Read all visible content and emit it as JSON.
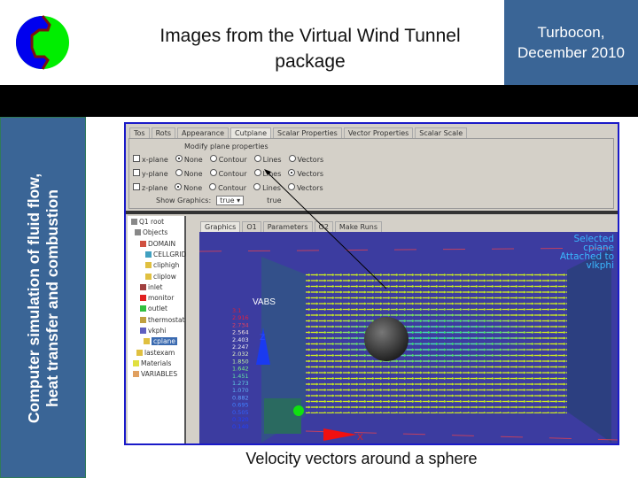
{
  "slide": {
    "title": "Images from the  Virtual Wind Tunnel package",
    "title_line1": "Images from the  Virtual Wind Tunnel",
    "title_line2": "package",
    "brand_line1": "Turbocon,",
    "brand_line2": "December 2010",
    "sidebar_line1": "Computer simulation of fluid flow,",
    "sidebar_line2": "heat transfer and combustion",
    "caption": "Velocity vectors around a sphere",
    "colors": {
      "brand_blue": "#3a6596",
      "band": "#000000",
      "frame": "#1a1ac8"
    }
  },
  "gui": {
    "top_tabs": [
      "Tos",
      "Rots",
      "Appearance",
      "Cutplane",
      "Scalar Properties",
      "Vector Properties",
      "Scalar Scale"
    ],
    "panel_title": "Modify plane properties",
    "rows": [
      {
        "label": "x-plane",
        "options": [
          "None",
          "Contour",
          "Lines",
          "Vectors"
        ],
        "selected": "None"
      },
      {
        "label": "y-plane",
        "options": [
          "None",
          "Contour",
          "Lines",
          "Vectors"
        ],
        "selected": "Vectors"
      },
      {
        "label": "z-plane",
        "options": [
          "None",
          "Contour",
          "Lines",
          "Vectors"
        ],
        "selected": "None"
      }
    ],
    "show_graphics_label": "Show Graphics:",
    "show_graphics_value": "true",
    "show_graphics_text": "true",
    "lower_tabs": [
      "Graphics",
      "O1",
      "Parameters",
      "O2",
      "Make Runs"
    ],
    "tree": [
      "Q1 root",
      "Objects",
      "DOMAIN",
      "CELLGRID",
      "cliphigh",
      "cliplow",
      "inlet",
      "monitor",
      "outlet",
      "thermostat",
      "vkphi",
      "cplane",
      "lastexam",
      "Materials",
      "VARIABLES"
    ]
  },
  "viz": {
    "legend_title": "VABS",
    "legend_values": [
      "3.1",
      "2.916",
      "2.734",
      "2.564",
      "2.403",
      "2.247",
      "2.032",
      "1.850",
      "1.642",
      "1.451",
      "1.273",
      "1.070",
      "0.882",
      "0.695",
      "0.505",
      "0.320",
      "0.140"
    ],
    "annotation": [
      "Selected",
      "cplane",
      "Attached to",
      "vlkphi"
    ],
    "axis_x": "X",
    "axis_z": "Z"
  }
}
